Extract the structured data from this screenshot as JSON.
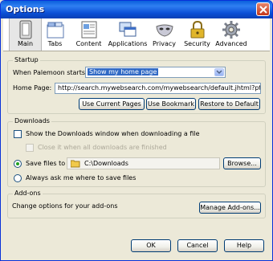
{
  "window": {
    "title": "Options"
  },
  "toolbar": {
    "tabs": [
      {
        "label": "Main",
        "icon": "switch-icon"
      },
      {
        "label": "Tabs",
        "icon": "tabs-icon"
      },
      {
        "label": "Content",
        "icon": "content-icon"
      },
      {
        "label": "Applications",
        "icon": "applications-icon"
      },
      {
        "label": "Privacy",
        "icon": "privacy-mask-icon"
      },
      {
        "label": "Security",
        "icon": "padlock-icon"
      },
      {
        "label": "Advanced",
        "icon": "gear-icon"
      }
    ],
    "selected": "Main"
  },
  "startup": {
    "group_label": "Startup",
    "when_starts_label": "When Palemoon starts:",
    "when_starts_value": "Show my home page",
    "home_page_label": "Home Page:",
    "home_page_value": "http://search.mywebsearch.com/mywebsearch/default.jhtml?ptnrS=ZJ",
    "use_current_pages": "Use Current Pages",
    "use_bookmark": "Use Bookmark",
    "restore_default": "Restore to Default"
  },
  "downloads": {
    "group_label": "Downloads",
    "show_window_label": "Show the Downloads window when downloading a file",
    "close_when_finished_label": "Close it when all downloads are finished",
    "save_files_to_label": "Save files to",
    "save_path": "C:\\Downloads",
    "browse": "Browse...",
    "always_ask_label": "Always ask me where to save files",
    "selected_option": "save_files_to"
  },
  "addons": {
    "group_label": "Add-ons",
    "description": "Change options for your add-ons",
    "manage_button": "Manage Add-ons..."
  },
  "footer": {
    "ok": "OK",
    "cancel": "Cancel",
    "help": "Help"
  },
  "colors": {
    "title_bar": "#0a5fdc",
    "dialog_bg": "#ece9d8",
    "close_red": "#c4371a"
  }
}
